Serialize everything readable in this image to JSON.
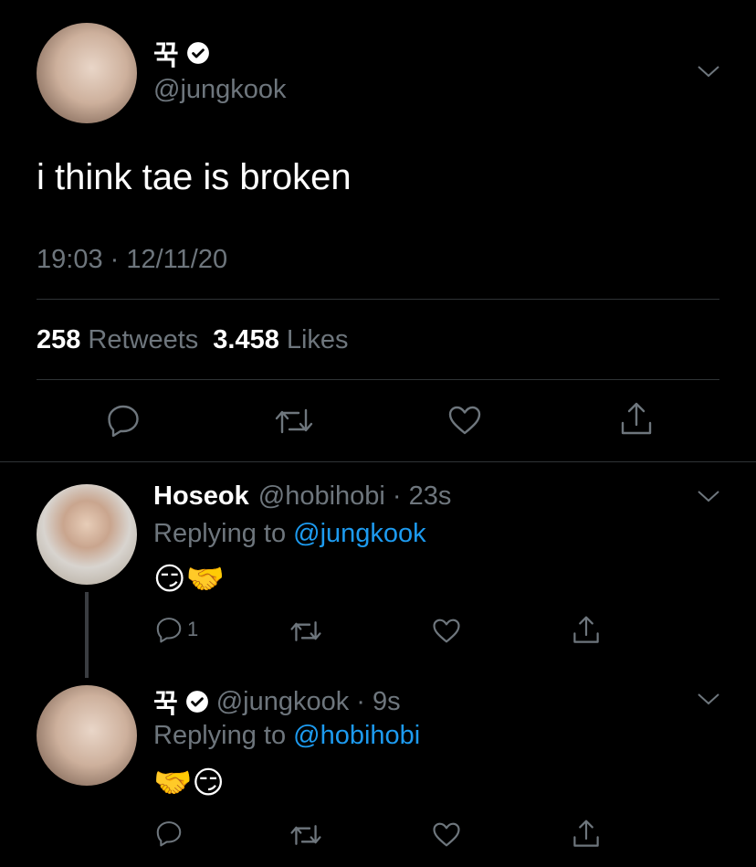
{
  "main_tweet": {
    "display_name": "꾹",
    "handle": "@jungkook",
    "text": "i think tae is broken",
    "timestamp": "19:03 · 12/11/20",
    "retweets_count": "258",
    "retweets_label": "Retweets",
    "likes_count": "3.458",
    "likes_label": "Likes"
  },
  "replies": [
    {
      "display_name": "Hoseok",
      "handle_time": "@hobihobi · 23s",
      "replying_prefix": "Replying to",
      "replying_to": "@jungkook",
      "emojis": "😏🤝",
      "reply_count": "1"
    },
    {
      "display_name": "꾹",
      "handle_time": "@jungkook · 9s",
      "replying_prefix": "Replying to",
      "replying_to": "@hobihobi",
      "emojis": "🤝😏"
    }
  ],
  "colors": {
    "background": "#000000",
    "muted": "#6e767d",
    "link": "#1d9bf0",
    "divider": "#2f3336"
  },
  "icons": [
    "verified-badge-icon",
    "chevron-down-icon",
    "reply-icon",
    "retweet-icon",
    "like-icon",
    "share-icon"
  ]
}
